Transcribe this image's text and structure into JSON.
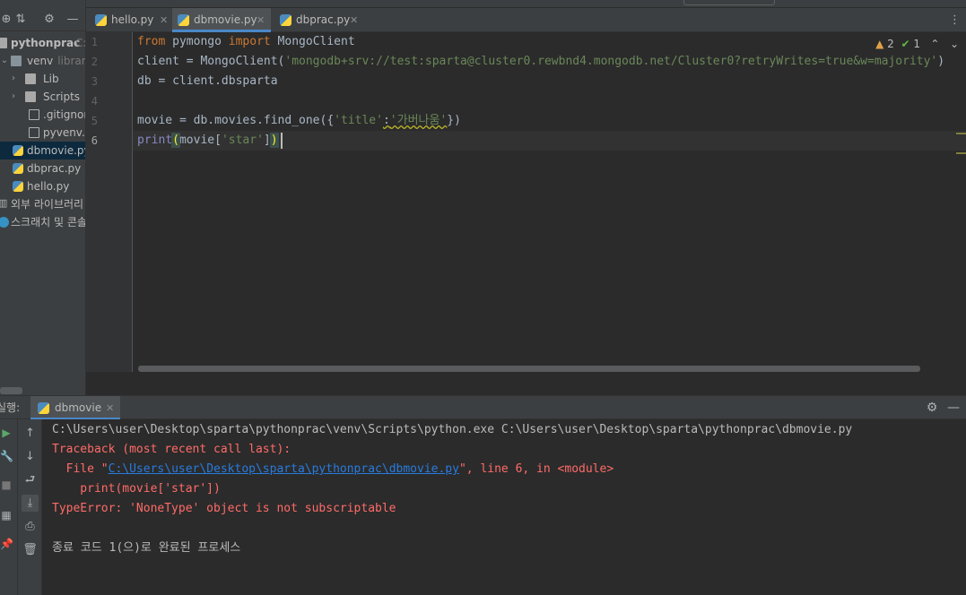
{
  "project": {
    "root": {
      "name": "pythonprac",
      "path_hint": "C:"
    },
    "items": [
      {
        "label": "venv",
        "hint": "library",
        "type": "folder-open"
      },
      {
        "label": "Lib",
        "type": "folder"
      },
      {
        "label": "Scripts",
        "type": "folder"
      },
      {
        "label": ".gitignore",
        "type": "file"
      },
      {
        "label": "pyvenv.cfg",
        "type": "file"
      },
      {
        "label": "dbmovie.py",
        "type": "python",
        "selected": true
      },
      {
        "label": "dbprac.py",
        "type": "python"
      },
      {
        "label": "hello.py",
        "type": "python"
      },
      {
        "label": "외부 라이브러리",
        "type": "libraries"
      },
      {
        "label": "스크래치 및 콘솔",
        "type": "scratches"
      }
    ]
  },
  "tabs": [
    {
      "label": "hello.py",
      "active": false
    },
    {
      "label": "dbmovie.py",
      "active": true
    },
    {
      "label": "dbprac.py",
      "active": false
    }
  ],
  "editor": {
    "line_numbers": [
      "1",
      "2",
      "3",
      "4",
      "5",
      "6"
    ],
    "inspections": {
      "warnings": "2",
      "ok": "1"
    },
    "code": {
      "l1_kw1": "from",
      "l1_mod": " pymongo ",
      "l1_kw2": "import",
      "l1_cls": " MongoClient",
      "l2_a": "client = MongoClient(",
      "l2_str": "'mongodb+srv://test:sparta@cluster0.rewbnd4.mongodb.net/Cluster0?retryWrites=true&w=majority'",
      "l2_b": ")",
      "l3": "db = client.dbsparta",
      "l5_a": "movie = db.movies.find_one({",
      "l5_key": "'title'",
      "l5_colon": ":",
      "l5_val": "'가버나움'",
      "l5_b": "})",
      "l6_fn": "print",
      "l6_open": "(",
      "l6_a": "movie[",
      "l6_str": "'star'",
      "l6_b": "]",
      "l6_close": ")"
    }
  },
  "run": {
    "title": "실행:",
    "tab_label": "dbmovie",
    "console": {
      "cmd": "C:\\Users\\user\\Desktop\\sparta\\pythonprac\\venv\\Scripts\\python.exe C:\\Users\\user\\Desktop\\sparta\\pythonprac\\dbmovie.py",
      "traceback": "Traceback (most recent call last):",
      "file_prefix": "  File \"",
      "file_path": "C:\\Users\\user\\Desktop\\sparta\\pythonprac\\dbmovie.py",
      "file_suffix": "\", line 6, in <module>",
      "code_line": "    print(movie['star'])",
      "error": "TypeError: 'NoneType' object is not subscriptable",
      "exit": "종료 코드 1(으)로 완료된 프로세스"
    }
  },
  "colors": {
    "keyword": "#cc7832",
    "string": "#6a8759",
    "builtin": "#8888c6",
    "error": "#ff6b68",
    "link": "#287bde",
    "accent": "#4a88c7"
  }
}
